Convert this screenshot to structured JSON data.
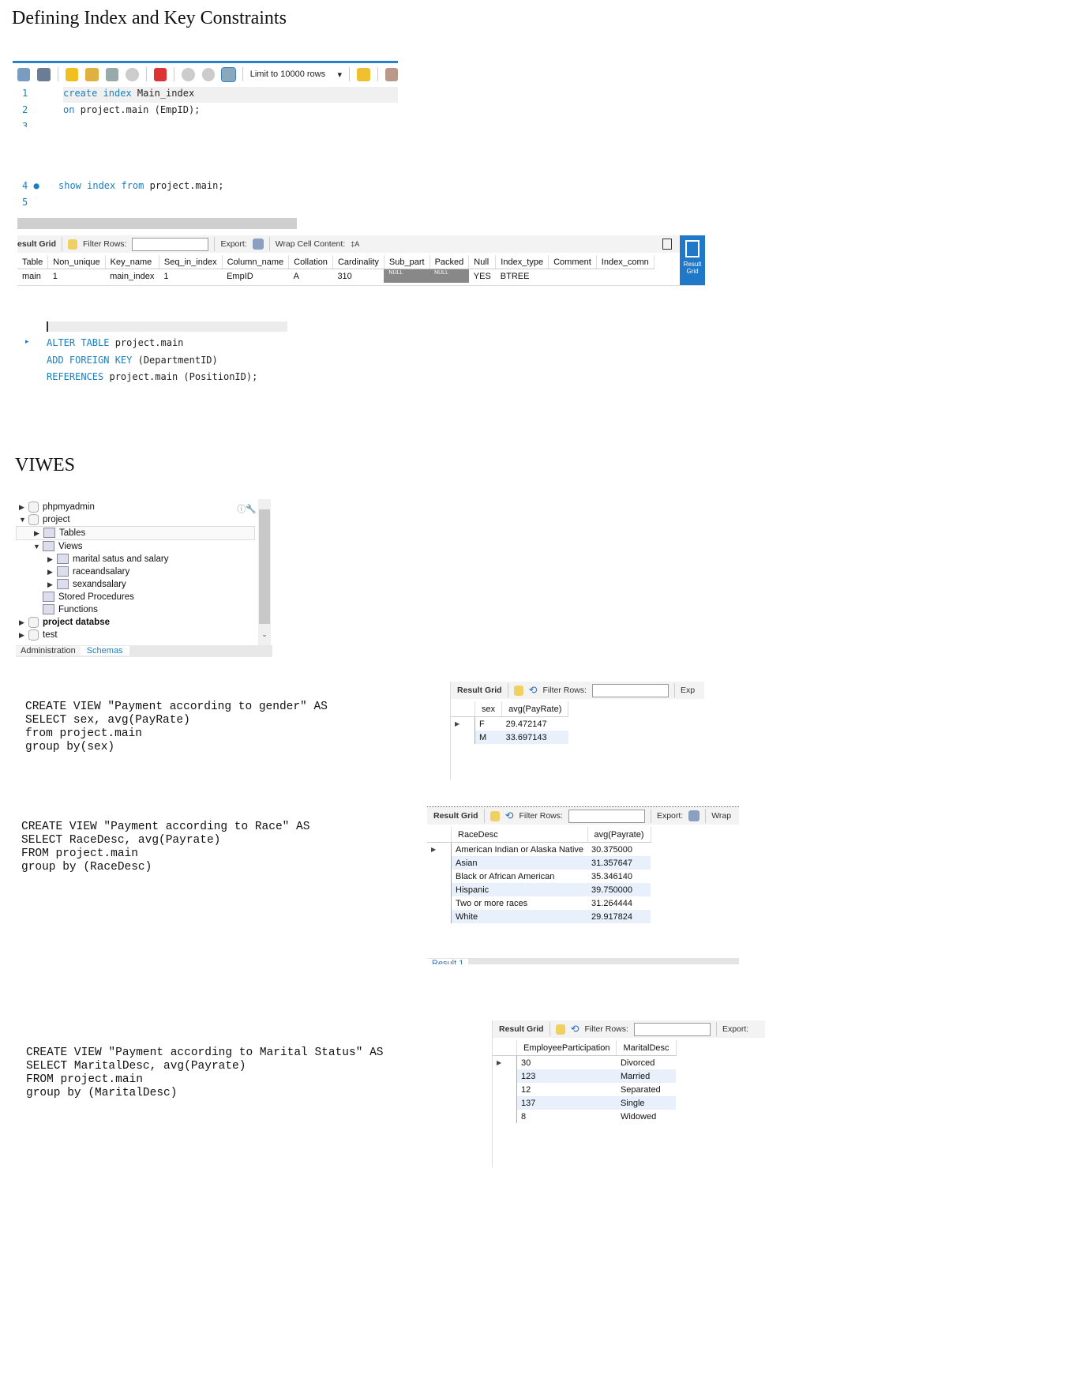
{
  "section1": {
    "title": "Defining Index and Key Constraints"
  },
  "toolbar": {
    "limit": "Limit to 10000 rows"
  },
  "editor1": {
    "lines": [
      {
        "n": "1",
        "kw": "create index ",
        "rest": "Main_index"
      },
      {
        "n": "2",
        "kw": "on ",
        "rest": "project.main (EmpID);"
      },
      {
        "n": "3",
        "kw": "",
        "rest": ""
      },
      {
        "n": "4 ●",
        "kw": "show index from ",
        "rest": "project.main;"
      },
      {
        "n": "5",
        "kw": "",
        "rest": ""
      }
    ]
  },
  "index_grid": {
    "label": "esult Grid",
    "filter": "Filter Rows:",
    "export": "Export:",
    "wrap": "Wrap Cell Content:",
    "side": "Result Grid",
    "columns": [
      "Table",
      "Non_unique",
      "Key_name",
      "Seq_in_index",
      "Column_name",
      "Collation",
      "Cardinality",
      "Sub_part",
      "Packed",
      "Null",
      "Index_type",
      "Comment",
      "Index_comn"
    ],
    "rows": [
      [
        "main",
        "1",
        "main_index",
        "1",
        "EmpID",
        "A",
        "310",
        "NULL",
        "NULL",
        "YES",
        "BTREE",
        "",
        ""
      ]
    ]
  },
  "alter": {
    "lines": [
      {
        "kw": "ALTER TABLE ",
        "rest": "project.main"
      },
      {
        "kw": "ADD FOREIGN KEY ",
        "rest": "(DepartmentID)"
      },
      {
        "kw": "REFERENCES ",
        "rest": "project.main (PositionID);"
      }
    ]
  },
  "section2": {
    "title": "VIWES"
  },
  "navigator": {
    "items": [
      {
        "label": "phpmyadmin",
        "level": 0,
        "arrow": "▶",
        "type": "db"
      },
      {
        "label": "project",
        "level": 0,
        "arrow": "▼",
        "type": "db"
      },
      {
        "label": "Tables",
        "level": 1,
        "arrow": "▶",
        "type": "folder"
      },
      {
        "label": "Views",
        "level": 1,
        "arrow": "▼",
        "type": "folder"
      },
      {
        "label": "marital satus and salary",
        "level": 2,
        "arrow": "▶",
        "type": "view"
      },
      {
        "label": "raceandsalary",
        "level": 2,
        "arrow": "▶",
        "type": "view"
      },
      {
        "label": "sexandsalary",
        "level": 2,
        "arrow": "▶",
        "type": "view"
      },
      {
        "label": "Stored Procedures",
        "level": 1,
        "arrow": "",
        "type": "folder"
      },
      {
        "label": "Functions",
        "level": 1,
        "arrow": "",
        "type": "folder"
      },
      {
        "label": "project databse",
        "level": 0,
        "arrow": "▶",
        "type": "db",
        "bold": true
      },
      {
        "label": "test",
        "level": 0,
        "arrow": "▶",
        "type": "db"
      }
    ],
    "tabs": [
      "Administration",
      "Schemas"
    ]
  },
  "view_gender": {
    "code": "CREATE VIEW \"Payment according to gender\" AS\nSELECT sex, avg(PayRate)\nfrom project.main\ngroup by(sex)",
    "grid": {
      "label": "Result Grid",
      "filter": "Filter Rows:",
      "export": "Exp",
      "columns": [
        "sex",
        "avg(PayRate)"
      ],
      "rows": [
        [
          "F",
          "29.472147"
        ],
        [
          "M",
          "33.697143"
        ]
      ]
    }
  },
  "view_race": {
    "code": "CREATE VIEW \"Payment according to Race\" AS\nSELECT RaceDesc, avg(Payrate)\nFROM project.main\ngroup by (RaceDesc)",
    "grid": {
      "label": "Result Grid",
      "filter": "Filter Rows:",
      "export": "Export:",
      "wrap": "Wrap",
      "tab": "Result 1",
      "columns": [
        "RaceDesc",
        "avg(Payrate)"
      ],
      "rows": [
        [
          "American Indian or Alaska Native",
          "30.375000"
        ],
        [
          "Asian",
          "31.357647"
        ],
        [
          "Black or African American",
          "35.346140"
        ],
        [
          "Hispanic",
          "39.750000"
        ],
        [
          "Two or more races",
          "31.264444"
        ],
        [
          "White",
          "29.917824"
        ]
      ]
    }
  },
  "view_marital": {
    "code": "CREATE VIEW \"Payment according to Marital Status\" AS\nSELECT MaritalDesc, avg(Payrate)\nFROM project.main\ngroup by (MaritalDesc)",
    "grid": {
      "label": "Result Grid",
      "filter": "Filter Rows:",
      "export": "Export:",
      "columns": [
        "EmployeeParticipation",
        "MaritalDesc"
      ],
      "rows": [
        [
          "30",
          "Divorced"
        ],
        [
          "123",
          "Married"
        ],
        [
          "12",
          "Separated"
        ],
        [
          "137",
          "Single"
        ],
        [
          "8",
          "Widowed"
        ]
      ]
    }
  }
}
